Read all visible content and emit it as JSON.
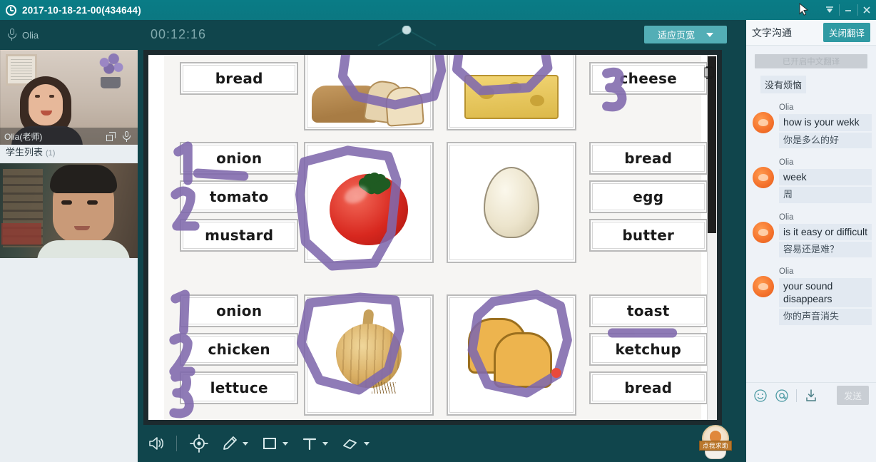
{
  "window": {
    "title": "2017-10-18-21-00(434644)",
    "clock_icon": "clock-icon",
    "controls": {
      "collapse": "chevron-down-icon",
      "minimize": "minimize-icon",
      "close": "close-icon"
    },
    "accent_teal": "#0b7781",
    "panel_dark": "#10454c"
  },
  "left_panel": {
    "header_mic_icon": "microphone-icon",
    "header_name": "Olia",
    "teacher_video": {
      "label": "Olia(老师)",
      "expand_icon": "expand-icon",
      "mic_icon": "microphone-icon"
    },
    "student_list": {
      "label": "学生列表",
      "count": "(1)"
    },
    "student_video": {
      "label": ""
    }
  },
  "center": {
    "timer": "00:12:16",
    "seek_handle_icon": "slider-handle-icon",
    "zoom_dropdown": {
      "label": "适应页宽",
      "caret_icon": "chevron-down-icon"
    },
    "scrollbar": {
      "name": "whiteboard-vertical-scrollbar"
    },
    "cursor_icon": "text-ibeam-cursor"
  },
  "worksheet": {
    "rows": [
      {
        "words_left": [
          "bread"
        ],
        "picture_left": "bread-loaf-and-slices",
        "picture_right": "cheese-block",
        "words_right": [
          "cheese"
        ],
        "annotations": [
          "circle-around-bread-picture",
          "circle-around-cheese-picture",
          "number-3-before-cheese"
        ]
      },
      {
        "words_left": [
          "onion",
          "tomato",
          "mustard"
        ],
        "picture_left": "tomato",
        "picture_right": "egg",
        "words_right": [
          "bread",
          "egg",
          "butter"
        ],
        "annotations": [
          "number-1-before-onion",
          "underline-after-onion",
          "number-2-before-tomato",
          "circle-around-tomato-picture"
        ]
      },
      {
        "words_left": [
          "onion",
          "chicken",
          "lettuce"
        ],
        "picture_left": "onion",
        "picture_right": "toast-slices",
        "words_right": [
          "toast",
          "ketchup",
          "bread"
        ],
        "annotations": [
          "number-1-before-onion",
          "number-2-before-chicken",
          "number-3-before-lettuce",
          "circle-around-onion-picture",
          "circle-around-toast-picture",
          "underline-under-toast",
          "red-dot-marker"
        ]
      }
    ],
    "ink_color": "#8069ad",
    "marker_dot_color": "#e8493c"
  },
  "toolbar": {
    "items": [
      {
        "name": "volume-icon",
        "label": "",
        "has_caret": false
      },
      {
        "name": "laser-pointer-icon",
        "label": "",
        "has_caret": false
      },
      {
        "name": "pencil-icon",
        "label": "",
        "has_caret": true
      },
      {
        "name": "rectangle-icon",
        "label": "",
        "has_caret": true
      },
      {
        "name": "text-tool-icon",
        "label": "T",
        "has_caret": true
      },
      {
        "name": "eraser-icon",
        "label": "",
        "has_caret": true
      }
    ],
    "help_badge": {
      "label": "点我求助"
    }
  },
  "chat": {
    "title": "文字沟通",
    "close_translation_button": "关闭翻译",
    "system_notice": "已开启中文翻译",
    "plain_message": "没有烦恼",
    "messages": [
      {
        "who": "Olia",
        "en": "how is your wekk",
        "zh": "你是多么的好"
      },
      {
        "who": "Olia",
        "en": "week",
        "zh": "周"
      },
      {
        "who": "Olia",
        "en": "is it easy or difficult",
        "zh": "容易还是难？"
      },
      {
        "who": "Olia",
        "en": "your sound disappears",
        "zh": "你的声音消失"
      }
    ],
    "tools": [
      {
        "name": "emoji-icon"
      },
      {
        "name": "mention-icon"
      },
      {
        "name": "download-icon"
      }
    ],
    "send_button": "发送",
    "input_placeholder": ""
  }
}
